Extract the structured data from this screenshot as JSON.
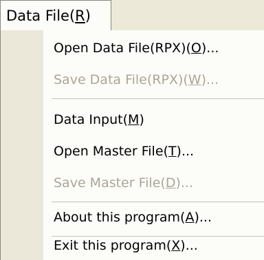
{
  "menu": {
    "title": "Data File(",
    "title_mnemonic": "R",
    "title_end": ")"
  },
  "items": [
    {
      "pre": "Open Data File(RPX)(",
      "key": "O",
      "post": ")...",
      "enabled": true
    },
    {
      "pre": "Save Data File(RPX)(",
      "key": "W",
      "post": ")...",
      "enabled": false
    },
    {
      "pre": "Data Input(",
      "key": "M",
      "post": ")",
      "enabled": true
    },
    {
      "pre": "Open Master File(",
      "key": "T",
      "post": ")...",
      "enabled": true
    },
    {
      "pre": "Save Master File(",
      "key": "D",
      "post": ")...",
      "enabled": false
    },
    {
      "pre": "About this program(",
      "key": "A",
      "post": ")...",
      "enabled": true
    },
    {
      "pre": "Exit this program(",
      "key": "X",
      "post": ")...",
      "enabled": true
    }
  ]
}
